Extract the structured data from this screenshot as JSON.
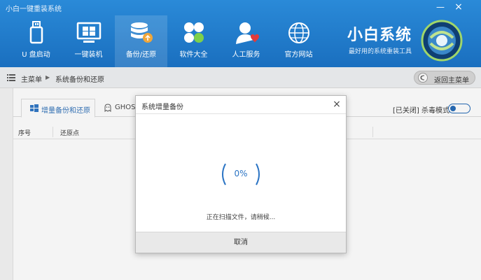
{
  "app": {
    "title": "小白一键重装系统",
    "min": "—",
    "close": "×"
  },
  "nav": [
    {
      "label": "U 盘启动",
      "icon": "usb-drive-icon"
    },
    {
      "label": "一键装机",
      "icon": "windows-icon"
    },
    {
      "label": "备份/还原",
      "icon": "database-icon"
    },
    {
      "label": "软件大全",
      "icon": "software-icon"
    },
    {
      "label": "人工服务",
      "icon": "support-person-icon"
    },
    {
      "label": "官方网站",
      "icon": "globe-icon"
    }
  ],
  "brand": {
    "name": "小白系统",
    "tagline": "最好用的系统重装工具"
  },
  "breadcrumb": {
    "root": "主菜单",
    "current": "系统备份和还原",
    "back": "返回主菜单"
  },
  "tabs": {
    "active": "增量备份和还原",
    "second": "GHOST"
  },
  "virus_mode": {
    "label": "[已关闭] 杀毒模式"
  },
  "table": {
    "col1": "序号",
    "col2": "还原点"
  },
  "dialog": {
    "title": "系统增量备份",
    "close": "×",
    "progress_text": "0%",
    "progress": 0,
    "status": "正在扫描文件，请稍候...",
    "cancel": "取消"
  },
  "colors": {
    "header": "#1a6fbf",
    "accent": "#2b74c4"
  }
}
